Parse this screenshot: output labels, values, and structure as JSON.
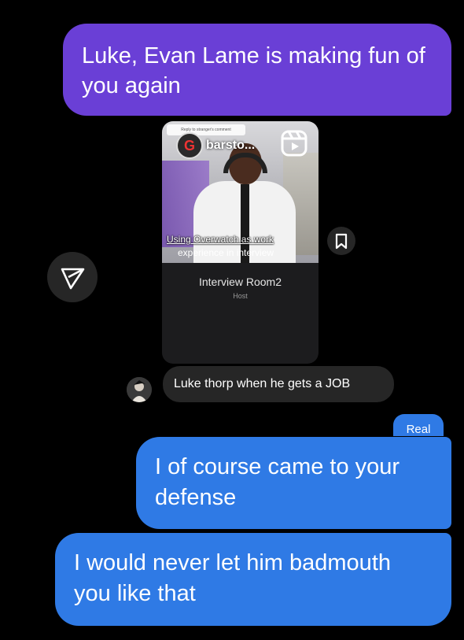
{
  "messages": {
    "outgoing_1": "Luke, Evan Lame is making fun of you again",
    "reply": "Luke thorp when he gets a JOB",
    "reaction": "Real",
    "outgoing_2": "I of course came to your defense",
    "outgoing_3": "I would never let him badmouth you like that"
  },
  "reel": {
    "comment_chip": "Reply to stranger's comment",
    "account_name": "barsto...",
    "caption_line1": "Using Overwatch as work",
    "caption_line2": "experience in interview",
    "room_title": "Interview Room2",
    "room_subtitle": "Host"
  },
  "icons": {
    "share": "send-icon",
    "save": "bookmark-icon",
    "reels": "reels-icon"
  },
  "colors": {
    "purple_bubble": "#6a3fd6",
    "blue_bubble": "#2f7ae5",
    "gray_bubble": "#262626"
  }
}
